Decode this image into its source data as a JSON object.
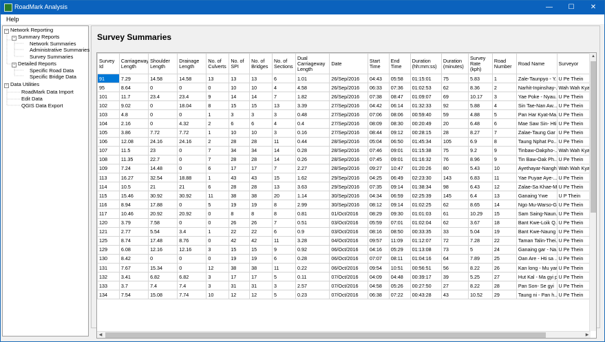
{
  "window": {
    "title": "RoadMark Analysis",
    "min_glyph": "—",
    "max_glyph": "☐",
    "close_glyph": "✕"
  },
  "menu": {
    "help": "Help"
  },
  "tree": {
    "network_reporting": "Network Reporting",
    "summary_reports": "Summary Reports",
    "network_summaries": "Network Summaries",
    "administrative_summaries": "Administrative Summaries",
    "survey_summaries": "Survey Summaries",
    "detailed_reports": "Detailed Reports",
    "specific_road_data": "Specific Road Data",
    "specific_bridge_data": "Specific Bridge Data",
    "data_utilities": "Data Utilities",
    "roadmark_data_import": "RoadMark Data Import",
    "edit_data": "Edit Data",
    "qgis_data_export": "QGIS Data Export",
    "expanded_glyph": "−"
  },
  "main": {
    "title": "Survey Summaries"
  },
  "table": {
    "headers": [
      "Survey Id",
      "Carriageway Length",
      "Shoulder Length",
      "Drainage Length",
      "No. of Culverts",
      "No. of SPI",
      "No. of Bridges",
      "No. of Sections",
      "Dual Carriageway Length",
      "Date",
      "Start Time",
      "End Time",
      "Duration (hh:mm:ss)",
      "Duration (minutes)",
      "Survey Rate (kph)",
      "Road Number",
      "Road Name",
      "Surveyor"
    ],
    "rows": [
      [
        "91",
        "7.29",
        "14.58",
        "14.58",
        "13",
        "13",
        "13",
        "6",
        "1.01",
        "26/Sep/2016",
        "04:43",
        "05:58",
        "01:15:01",
        "75",
        "5.83",
        "1",
        "Zale-Taunpyo - Y...",
        "U Pe Thein"
      ],
      [
        "95",
        "8.64",
        "0",
        "0",
        "0",
        "10",
        "10",
        "4",
        "4.58",
        "26/Sep/2016",
        "06:33",
        "07:36",
        "01:02:53",
        "62",
        "8.36",
        "2",
        "Narhit-Inpinshay-...",
        "Wah Wah Kyaw"
      ],
      [
        "101",
        "11.7",
        "23.4",
        "23.4",
        "9",
        "14",
        "14",
        "7",
        "1.82",
        "26/Sep/2016",
        "07:38",
        "08:47",
        "01:09:07",
        "69",
        "10.17",
        "3",
        "Yae Poke - Nyau...",
        "U Pe Thein"
      ],
      [
        "102",
        "9.02",
        "0",
        "18.04",
        "8",
        "15",
        "15",
        "13",
        "3.39",
        "27/Sep/2016",
        "04:42",
        "06:14",
        "01:32:33",
        "92",
        "5.88",
        "4",
        "Sin Tae-Nan Aw...",
        "U Pe Thein"
      ],
      [
        "103",
        "4.8",
        "0",
        "0",
        "1",
        "3",
        "3",
        "3",
        "0.48",
        "27/Sep/2016",
        "07:06",
        "08:06",
        "00:59:40",
        "59",
        "4.88",
        "5",
        "Pan Har Kyat-Ma...",
        "U Pe Thein"
      ],
      [
        "104",
        "2.16",
        "0",
        "4.32",
        "2",
        "6",
        "6",
        "4",
        "0.4",
        "27/Sep/2016",
        "08:09",
        "08:30",
        "00:20:49",
        "20",
        "6.48",
        "6",
        "Mae Saw Sin- Hti...",
        "U Pe Thein"
      ],
      [
        "105",
        "3.86",
        "7.72",
        "7.72",
        "1",
        "10",
        "10",
        "3",
        "0.16",
        "27/Sep/2016",
        "08:44",
        "09:12",
        "00:28:15",
        "28",
        "8.27",
        "7",
        "Zalae-Taung Gar",
        "U Pe Thein"
      ],
      [
        "106",
        "12.08",
        "24.16",
        "24.16",
        "2",
        "28",
        "28",
        "11",
        "0.44",
        "28/Sep/2016",
        "05:04",
        "06:50",
        "01:45:34",
        "105",
        "6.9",
        "8",
        "Taung Nphat Po...",
        "U Pe Thein"
      ],
      [
        "107",
        "11.5",
        "23",
        "0",
        "7",
        "34",
        "34",
        "14",
        "0.28",
        "28/Sep/2016",
        "07:46",
        "09:01",
        "01:15:38",
        "75",
        "9.2",
        "9",
        "Tinbaw-Oakpho-...",
        "Wah Wah Kyaw"
      ],
      [
        "108",
        "11.35",
        "22.7",
        "0",
        "7",
        "28",
        "28",
        "14",
        "0.26",
        "28/Sep/2016",
        "07:45",
        "09:01",
        "01:16:32",
        "76",
        "8.96",
        "9",
        "Tin Baw-Oak Ph...",
        "U Pe Thein"
      ],
      [
        "109",
        "7.24",
        "14.48",
        "0",
        "6",
        "17",
        "17",
        "7",
        "2.27",
        "28/Sep/2016",
        "09:27",
        "10:47",
        "01:20:26",
        "80",
        "5.43",
        "10",
        "Ayethayar-Nangh...",
        "Wah Wah Kyaw"
      ],
      [
        "113",
        "16.27",
        "32.54",
        "18.88",
        "1",
        "43",
        "43",
        "15",
        "1.62",
        "29/Sep/2016",
        "04:25",
        "06:49",
        "02:23:30",
        "143",
        "6.83",
        "11",
        "Yae Puyae Aye-...",
        "U Pe Thein"
      ],
      [
        "114",
        "10.5",
        "21",
        "21",
        "6",
        "28",
        "28",
        "13",
        "3.63",
        "29/Sep/2016",
        "07:35",
        "09:14",
        "01:38:34",
        "98",
        "6.43",
        "12",
        "Zalae-Sa Khae-M...",
        "U Pe Thein"
      ],
      [
        "115",
        "15.46",
        "30.92",
        "30.92",
        "11",
        "38",
        "38",
        "20",
        "1.14",
        "30/Sep/2016",
        "04:34",
        "06:59",
        "02:25:39",
        "145",
        "6.4",
        "13",
        "Ganaing Ywe",
        "U P Thein"
      ],
      [
        "116",
        "8.94",
        "17.88",
        "0",
        "5",
        "19",
        "19",
        "8",
        "2.99",
        "30/Sep/2016",
        "08:12",
        "09:14",
        "01:02:25",
        "62",
        "8.65",
        "14",
        "Ngo Mu-Warso-G...",
        "U Pe Thein"
      ],
      [
        "117",
        "10.46",
        "20.92",
        "20.92",
        "0",
        "8",
        "8",
        "8",
        "0.81",
        "01/Oct/2016",
        "08:29",
        "09:30",
        "01:01:03",
        "61",
        "10.29",
        "15",
        "Sam Saing-Naun...",
        "U Pe Thein"
      ],
      [
        "120",
        "3.79",
        "7.58",
        "0",
        "0",
        "26",
        "26",
        "7",
        "0.51",
        "03/Oct/2016",
        "05:59",
        "07:01",
        "01:02:04",
        "62",
        "3.67",
        "18",
        "Bant Kwe-Loik Q...",
        "U Pe Thein"
      ],
      [
        "121",
        "2.77",
        "5.54",
        "3.4",
        "1",
        "22",
        "22",
        "6",
        "0.9",
        "03/Oct/2016",
        "08:16",
        "08:50",
        "00:33:35",
        "33",
        "5.04",
        "19",
        "Bant Kwe-Naung ...",
        "U Pe Thein"
      ],
      [
        "125",
        "8.74",
        "17.48",
        "8.76",
        "0",
        "42",
        "42",
        "11",
        "3.28",
        "04/Oct/2016",
        "09:57",
        "11:09",
        "01:12:07",
        "72",
        "7.28",
        "22",
        "Taman Talin-Thei...",
        "U Pe Thein"
      ],
      [
        "129",
        "6.08",
        "12.16",
        "12.16",
        "3",
        "15",
        "15",
        "9",
        "0.92",
        "06/Oct/2016",
        "04:16",
        "05:29",
        "01:13:08",
        "73",
        "5",
        "24",
        "Ganaing gar - Na...",
        "U Pe Thein"
      ],
      [
        "130",
        "8.42",
        "0",
        "0",
        "0",
        "19",
        "19",
        "6",
        "0.28",
        "06/Oct/2016",
        "07:07",
        "08:11",
        "01:04:16",
        "64",
        "7.89",
        "25",
        "Oan Are - Hti sa ...",
        "U Pe Thein"
      ],
      [
        "131",
        "7.67",
        "15.34",
        "0",
        "12",
        "38",
        "38",
        "11",
        "0.22",
        "06/Oct/2016",
        "09:54",
        "10:51",
        "00:56:51",
        "56",
        "8.22",
        "26",
        "Kan long - Mu yar...",
        "U Pe Thein"
      ],
      [
        "132",
        "3.41",
        "6.82",
        "6.82",
        "3",
        "17",
        "17",
        "5",
        "0.11",
        "07/Oct/2016",
        "04:09",
        "04:48",
        "00:39:17",
        "39",
        "5.25",
        "27",
        "Hut Kal - Ma gyi pin",
        "U Pe Thein"
      ],
      [
        "133",
        "3.7",
        "7.4",
        "7.4",
        "3",
        "31",
        "31",
        "3",
        "2.57",
        "07/Oct/2016",
        "04:58",
        "05:26",
        "00:27:50",
        "27",
        "8.22",
        "28",
        "Pan Son- Se gyi",
        "U Pe Thein"
      ],
      [
        "134",
        "7.54",
        "15.08",
        "7.74",
        "10",
        "12",
        "12",
        "5",
        "0.23",
        "07/Oct/2016",
        "06:38",
        "07:22",
        "00:43:28",
        "43",
        "10.52",
        "29",
        "Taung ni - Pan h...",
        "U Pe Thein"
      ]
    ]
  },
  "scroll": {
    "up_glyph": "▲",
    "left_glyph": "◀",
    "right_glyph": "▶"
  },
  "colors": {
    "titlebar": "#0b62bd",
    "selection": "#0078d7"
  }
}
